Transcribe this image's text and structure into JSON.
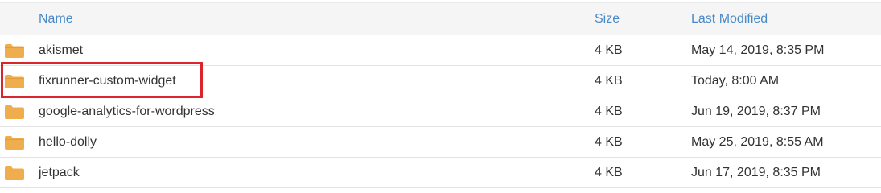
{
  "columns": {
    "name": "Name",
    "size": "Size",
    "modified": "Last Modified"
  },
  "rows": [
    {
      "name": "akismet",
      "size": "4 KB",
      "modified": "May 14, 2019, 8:35 PM",
      "icon": "folder-icon"
    },
    {
      "name": "fixrunner-custom-widget",
      "size": "4 KB",
      "modified": "Today, 8:00 AM",
      "icon": "folder-icon",
      "highlighted": true
    },
    {
      "name": "google-analytics-for-wordpress",
      "size": "4 KB",
      "modified": "Jun 19, 2019, 8:37 PM",
      "icon": "folder-icon"
    },
    {
      "name": "hello-dolly",
      "size": "4 KB",
      "modified": "May 25, 2019, 8:55 AM",
      "icon": "folder-icon"
    },
    {
      "name": "jetpack",
      "size": "4 KB",
      "modified": "Jun 17, 2019, 8:35 PM",
      "icon": "folder-icon"
    }
  ],
  "colors": {
    "folder": "#f0ad4e",
    "folder_tab": "#e39c36",
    "header_link": "#4a89c8",
    "highlight": "#d9262c"
  }
}
